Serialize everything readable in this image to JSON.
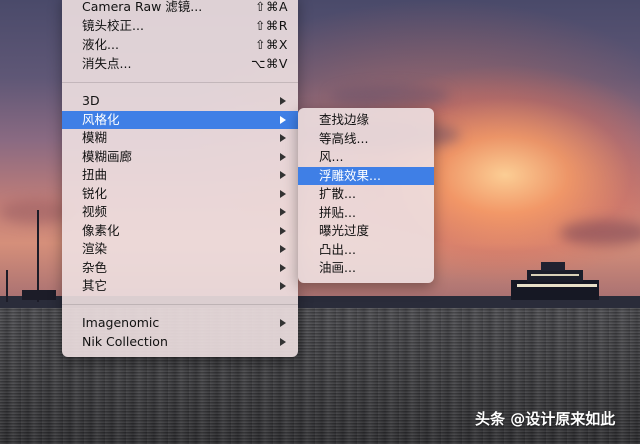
{
  "main_menu": {
    "top_items": [
      {
        "label": "Camera Raw 滤镜...",
        "shortcut": "⇧⌘A"
      },
      {
        "label": "镜头校正...",
        "shortcut": "⇧⌘R"
      },
      {
        "label": "液化...",
        "shortcut": "⇧⌘X"
      },
      {
        "label": "消失点...",
        "shortcut": "⌥⌘V"
      }
    ],
    "filter_items": [
      {
        "label": "3D"
      },
      {
        "label": "风格化"
      },
      {
        "label": "模糊"
      },
      {
        "label": "模糊画廊"
      },
      {
        "label": "扭曲"
      },
      {
        "label": "锐化"
      },
      {
        "label": "视频"
      },
      {
        "label": "像素化"
      },
      {
        "label": "渲染"
      },
      {
        "label": "杂色"
      },
      {
        "label": "其它"
      }
    ],
    "plugin_items": [
      {
        "label": "Imagenomic"
      },
      {
        "label": "Nik Collection"
      }
    ],
    "highlighted": "风格化"
  },
  "submenu": {
    "items": [
      {
        "label": "查找边缘"
      },
      {
        "label": "等高线..."
      },
      {
        "label": "风..."
      },
      {
        "label": "浮雕效果..."
      },
      {
        "label": "扩散..."
      },
      {
        "label": "拼贴..."
      },
      {
        "label": "曝光过度"
      },
      {
        "label": "凸出..."
      },
      {
        "label": "油画..."
      }
    ],
    "highlighted": "浮雕效果..."
  },
  "watermark": "头条 @设计原来如此",
  "colors": {
    "highlight": "#3f7fe6",
    "menu_background": "#eee0e1"
  }
}
